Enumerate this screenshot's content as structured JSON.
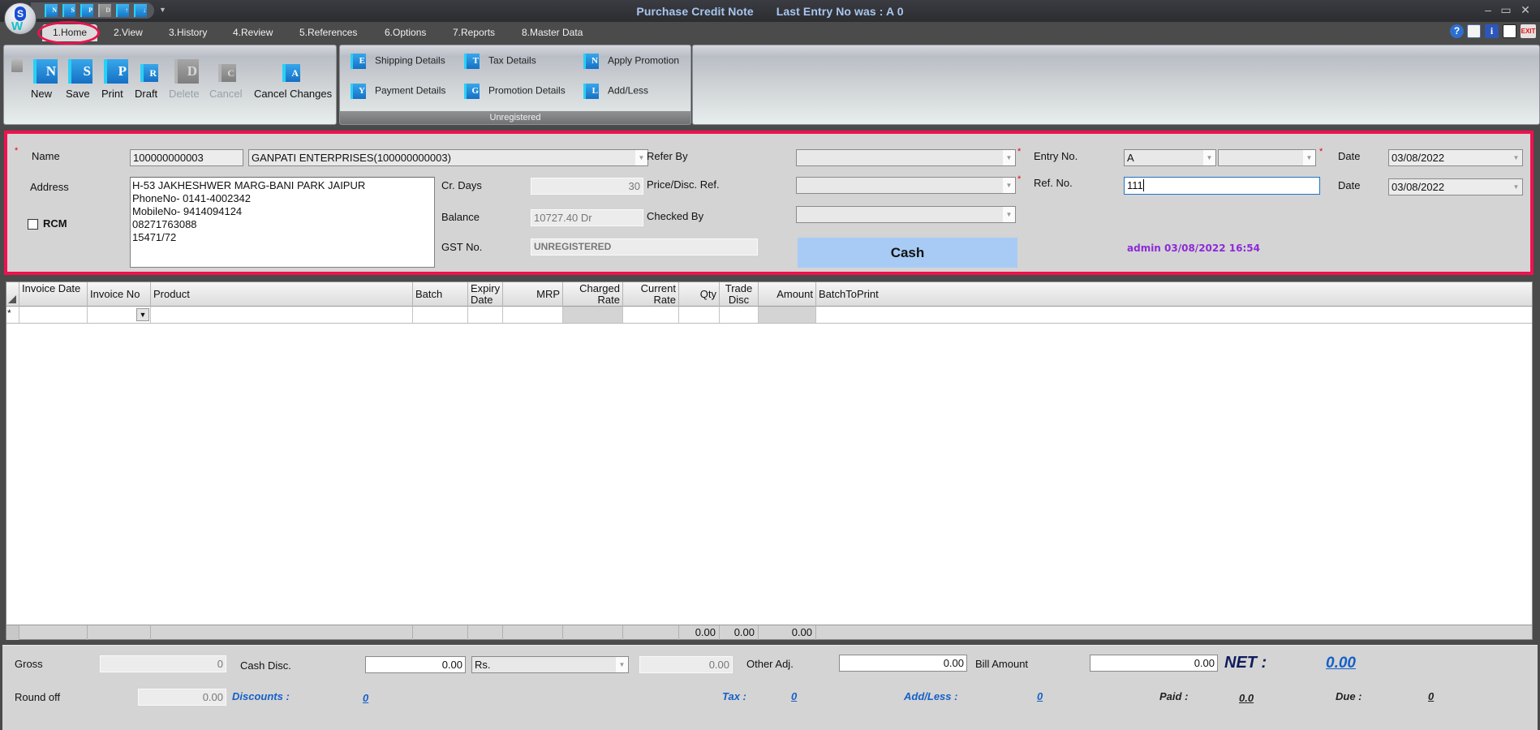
{
  "window": {
    "title": "Purchase Credit Note",
    "last_entry": "Last Entry No was : A 0",
    "minimize": "–",
    "maximize": "▭",
    "close": "✕"
  },
  "quick_access": [
    {
      "icon": "new-icon",
      "glyph": "N"
    },
    {
      "icon": "save-icon",
      "glyph": "S"
    },
    {
      "icon": "print-icon",
      "glyph": "P"
    },
    {
      "icon": "delete-icon",
      "glyph": "D",
      "disabled": true
    },
    {
      "icon": "move-up-icon",
      "glyph": "↑"
    },
    {
      "icon": "move-down-icon",
      "glyph": "↓"
    }
  ],
  "menu": {
    "tabs": [
      "1.Home",
      "2.View",
      "3.History",
      "4.Review",
      "5.References",
      "6.Options",
      "7.Reports",
      "8.Master Data"
    ],
    "active": "1.Home",
    "right_icons": [
      "help-icon",
      "monitor-icon",
      "info-icon",
      "document-icon",
      "exit-icon"
    ]
  },
  "ribbon": {
    "main_buttons": [
      {
        "label": "New",
        "glyph": "N"
      },
      {
        "label": "Save",
        "glyph": "S"
      },
      {
        "label": "Print",
        "glyph": "P"
      },
      {
        "label": "Draft",
        "glyph": "R"
      },
      {
        "label": "Delete",
        "glyph": "D",
        "disabled": true
      },
      {
        "label": "Cancel",
        "glyph": "C",
        "disabled": true
      },
      {
        "label": "Cancel Changes",
        "glyph": "A"
      }
    ],
    "detail_buttons": [
      {
        "label": "Shipping Details",
        "glyph": "E"
      },
      {
        "label": "Tax Details",
        "glyph": "T"
      },
      {
        "label": "Apply Promotion",
        "glyph": "N"
      },
      {
        "label": "Payment Details",
        "glyph": "Y"
      },
      {
        "label": "Promotion Details",
        "glyph": "G"
      },
      {
        "label": "Add/Less",
        "glyph": "L"
      }
    ],
    "group_footer": "Unregistered"
  },
  "form": {
    "name_label": "Name",
    "name_code": "100000000003",
    "name_value": "GANPATI ENTERPRISES(100000000003)",
    "address_label": "Address",
    "address_lines": [
      "H-53 JAKHESHWER MARG-BANI PARK JAIPUR",
      "PhoneNo- 0141-4002342",
      "MobileNo- 9414094124",
      "08271763088",
      "15471/72"
    ],
    "rcm_label": "RCM",
    "rcm_checked": false,
    "cr_days_label": "Cr. Days",
    "cr_days": "30",
    "balance_label": "Balance",
    "balance": "10727.40 Dr",
    "gst_label": "GST No.",
    "gst": "UNREGISTERED",
    "refer_by_label": "Refer By",
    "refer_by": "",
    "price_ref_label": "Price/Disc. Ref.",
    "price_ref": "",
    "checked_by_label": "Checked By",
    "checked_by": "",
    "payment_mode": "Cash",
    "entry_no_label": "Entry No.",
    "entry_series": "A",
    "entry_no": "",
    "ref_no_label": "Ref. No.",
    "ref_no": "111",
    "date_label": "Date",
    "entry_date": "03/08/2022",
    "ref_date_label": "Date",
    "ref_date": "03/08/2022",
    "audit": "admin 03/08/2022 16:54",
    "required_mark": "*"
  },
  "grid": {
    "columns": [
      {
        "label": "Invoice Date",
        "two_line": true
      },
      {
        "label": "Invoice No"
      },
      {
        "label": "Product"
      },
      {
        "label": "Batch"
      },
      {
        "label": "Expiry Date",
        "two_line": true
      },
      {
        "label": "MRP",
        "right": true
      },
      {
        "label": "Charged Rate",
        "two_line": true,
        "right": true
      },
      {
        "label": "Current Rate",
        "two_line": true,
        "right": true
      },
      {
        "label": "Qty",
        "right": true
      },
      {
        "label": "Trade Disc",
        "two_line": true
      },
      {
        "label": "Amount",
        "right": true
      },
      {
        "label": "BatchToPrint"
      }
    ],
    "new_row_marker": "*",
    "rows": [],
    "footer_totals": {
      "qty": "0.00",
      "trade_disc": "0.00",
      "amount": "0.00"
    }
  },
  "totals": {
    "gross_label": "Gross",
    "gross": "0",
    "cash_disc_label": "Cash Disc.",
    "cash_disc": "0.00",
    "cash_disc_type": "Rs.",
    "cash_disc_amount": "0.00",
    "other_adj_label": "Other Adj.",
    "other_adj": "0.00",
    "bill_amount_label": "Bill Amount",
    "bill_amount": "0.00",
    "net_label": "NET :",
    "net": "0.00",
    "round_off_label": "Round off",
    "round_off": "0.00",
    "discounts_label": "Discounts :",
    "discounts": "0",
    "tax_label": "Tax :",
    "tax": "0",
    "add_less_label": "Add/Less :",
    "add_less": "0",
    "paid_label": "Paid :",
    "paid": "0.0",
    "due_label": "Due :",
    "due": "0"
  }
}
